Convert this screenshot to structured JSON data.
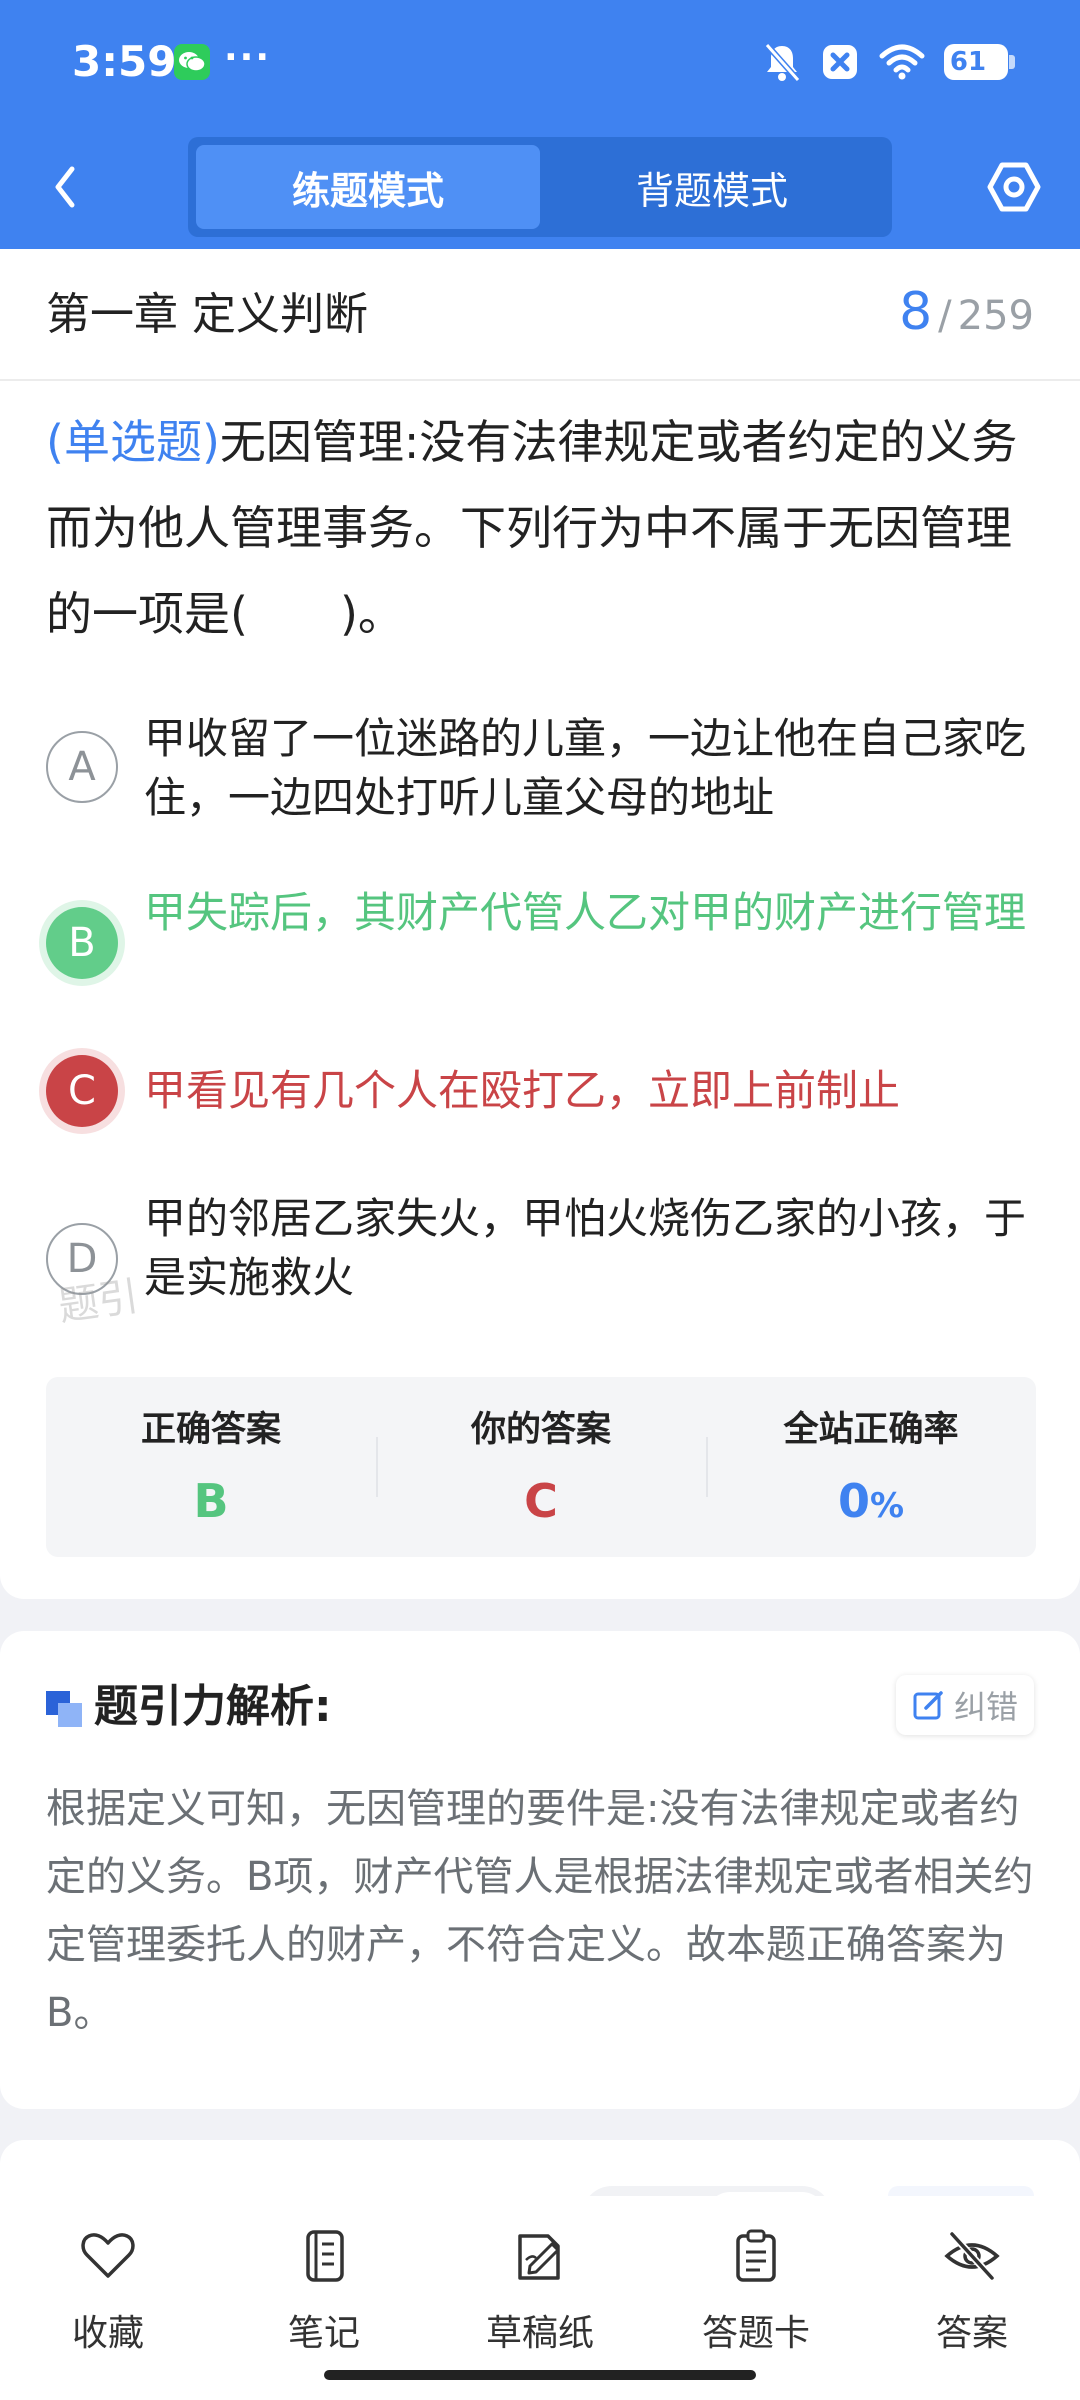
{
  "status_bar": {
    "time": "3:59",
    "more": "···",
    "battery": "61",
    "icons": [
      "wechat-icon",
      "bell-off-icon",
      "close-box-icon",
      "wifi-icon",
      "battery-icon"
    ]
  },
  "nav": {
    "tabs": [
      "练题模式",
      "背题模式"
    ],
    "active_tab": "练题模式"
  },
  "chapter": {
    "title": "第一章 定义判断",
    "current": "8",
    "separator": "/",
    "total": "259"
  },
  "question": {
    "type": "(单选题)",
    "text": "无因管理:没有法律规定或者约定的义务而为他人管理事务。下列行为中不属于无因管理的一项是(　　)。"
  },
  "options": [
    {
      "letter": "A",
      "text": "甲收留了一位迷路的儿童，一边让他在自己家吃住，一边四处打听儿童父母的地址",
      "state": "normal"
    },
    {
      "letter": "B",
      "text": "甲失踪后，其财产代管人乙对甲的财产进行管理",
      "state": "correct"
    },
    {
      "letter": "C",
      "text": "甲看见有几个人在殴打乙，立即上前制止",
      "state": "wrong"
    },
    {
      "letter": "D",
      "text": "甲的邻居乙家失火，甲怕火烧伤乙家的小孩，于是实施救火",
      "state": "normal"
    }
  ],
  "watermark": "题引",
  "result": {
    "correct_label": "正确答案",
    "correct_value": "B",
    "yours_label": "你的答案",
    "yours_value": "C",
    "rate_label": "全站正确率",
    "rate_value": "0",
    "rate_unit": "%"
  },
  "analysis": {
    "title": "题引力解析:",
    "report_label": "纠错",
    "text": "根据定义可知，无因管理的要件是:没有法律规定或者约定的义务。B项，财产代管人是根据法律规定或者相关约定管理委托人的财产，不符合定义。故本题正确答案为B。"
  },
  "toolbar": {
    "items": [
      {
        "label": "收藏",
        "icon": "heart-icon"
      },
      {
        "label": "笔记",
        "icon": "notebook-icon"
      },
      {
        "label": "草稿纸",
        "icon": "draft-pen-icon"
      },
      {
        "label": "答题卡",
        "icon": "clipboard-icon"
      },
      {
        "label": "答案",
        "icon": "eye-off-icon"
      }
    ]
  },
  "colors": {
    "primary": "#3f82f0",
    "correct": "#55c57f",
    "wrong": "#c94447",
    "muted": "#9aa0a6"
  }
}
